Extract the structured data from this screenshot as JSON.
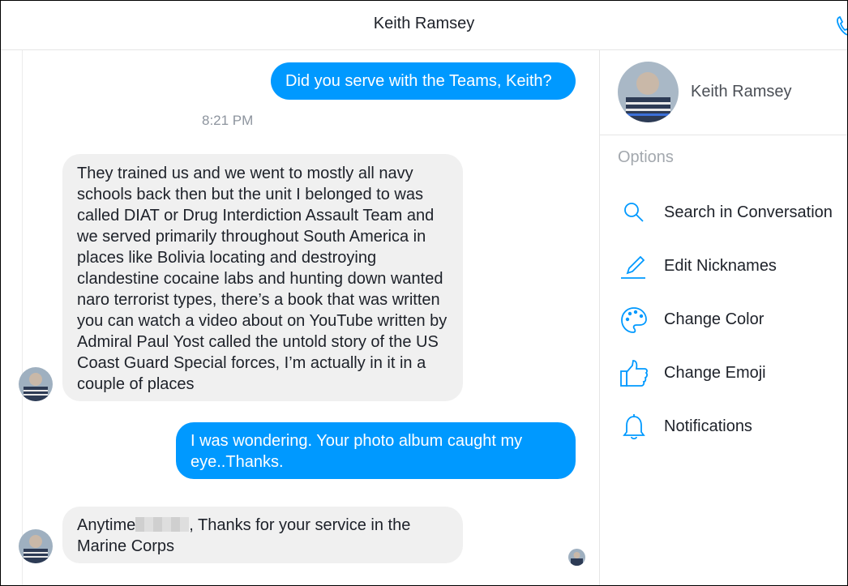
{
  "header": {
    "title": "Keith Ramsey"
  },
  "conversation": {
    "messages": [
      {
        "direction": "outgoing",
        "text": "Did you serve with the Teams, Keith?"
      },
      {
        "direction": "incoming",
        "text": "They trained us and we went to mostly all navy schools back then but the unit I belonged to was called DIAT or Drug Interdiction Assault Team and we served primarily throughout South America in places like Bolivia locating and destroying clandestine cocaine labs and hunting down wanted naro terrorist types, there’s a book that was written you can watch a video about on YouTube written by Admiral Paul Yost called the untold story of the US Coast Guard Special forces, I’m actually in it in a couple of places"
      },
      {
        "direction": "outgoing",
        "text": "I was wondering. Your photo album caught my eye..Thanks."
      },
      {
        "direction": "incoming",
        "text_before": "Anytime",
        "text_after": ", Thanks for your service in the Marine Corps",
        "redacted": true
      }
    ],
    "timestamp": "8:21 PM"
  },
  "sidebar": {
    "profile_name": "Keith Ramsey",
    "options_title": "Options",
    "options": [
      {
        "label": "Search in Conversation",
        "icon": "search-icon"
      },
      {
        "label": "Edit Nicknames",
        "icon": "pencil-icon"
      },
      {
        "label": "Change Color",
        "icon": "palette-icon"
      },
      {
        "label": "Change Emoji",
        "icon": "thumbs-up-icon"
      },
      {
        "label": "Notifications",
        "icon": "bell-icon"
      }
    ]
  },
  "colors": {
    "accent": "#0099ff",
    "incoming_bubble": "#f0f0f0",
    "link_text": "#4b4f56"
  }
}
